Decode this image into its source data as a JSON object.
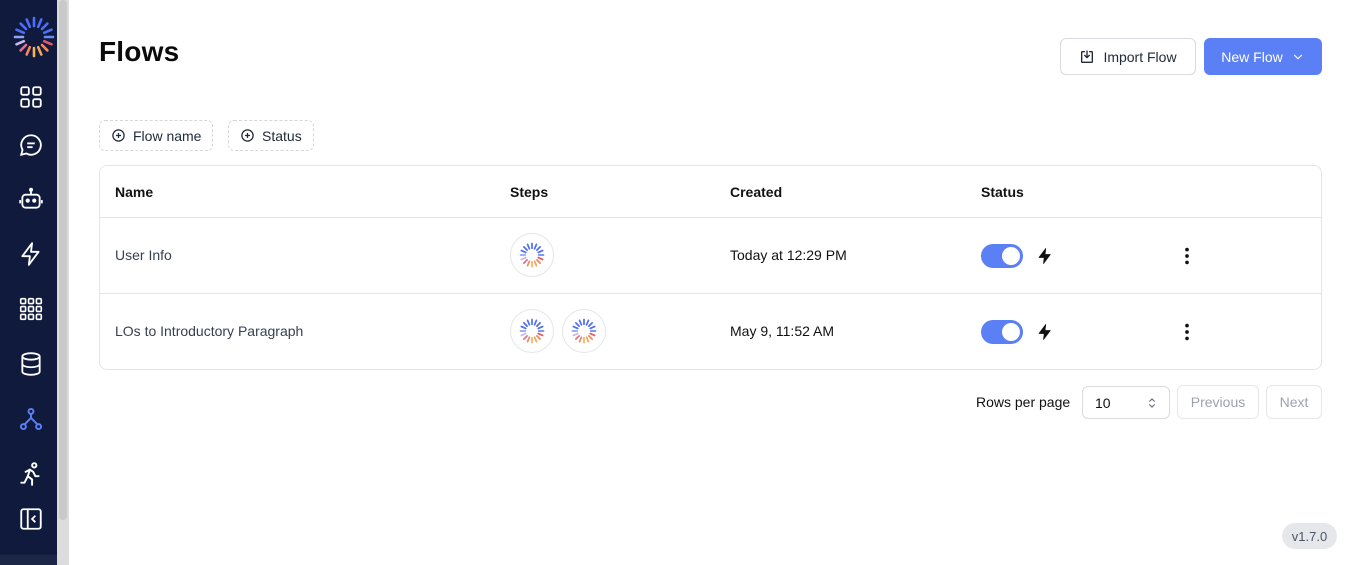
{
  "sidebar": {
    "items": [
      {
        "name": "dashboard",
        "icon": "grid-icon"
      },
      {
        "name": "chat",
        "icon": "chat-icon"
      },
      {
        "name": "bots",
        "icon": "robot-icon"
      },
      {
        "name": "triggers",
        "icon": "bolt-icon"
      },
      {
        "name": "apps",
        "icon": "apps-grid-icon"
      },
      {
        "name": "data",
        "icon": "database-icon"
      },
      {
        "name": "flows",
        "icon": "flow-icon",
        "active": true
      },
      {
        "name": "runs",
        "icon": "runner-icon"
      },
      {
        "name": "collapse",
        "icon": "collapse-sidebar-icon"
      }
    ]
  },
  "header": {
    "title": "Flows",
    "import_label": "Import Flow",
    "new_label": "New Flow"
  },
  "filters": [
    {
      "label": "Flow name"
    },
    {
      "label": "Status"
    }
  ],
  "table": {
    "columns": [
      "Name",
      "Steps",
      "Created",
      "Status"
    ],
    "rows": [
      {
        "name": "User Info",
        "steps": 1,
        "created": "Today at 12:29 PM",
        "enabled": true
      },
      {
        "name": "LOs to Introductory Paragraph",
        "steps": 2,
        "created": "May 9, 11:52 AM",
        "enabled": true
      }
    ]
  },
  "pagination": {
    "rows_per_page_label": "Rows per page",
    "rows_per_page_value": "10",
    "previous_label": "Previous",
    "next_label": "Next"
  },
  "version": "v1.7.0",
  "colors": {
    "sidebar_bg": "#0f1a3d",
    "accent": "#5b7ff5",
    "active_nav": "#5b7ff5"
  }
}
